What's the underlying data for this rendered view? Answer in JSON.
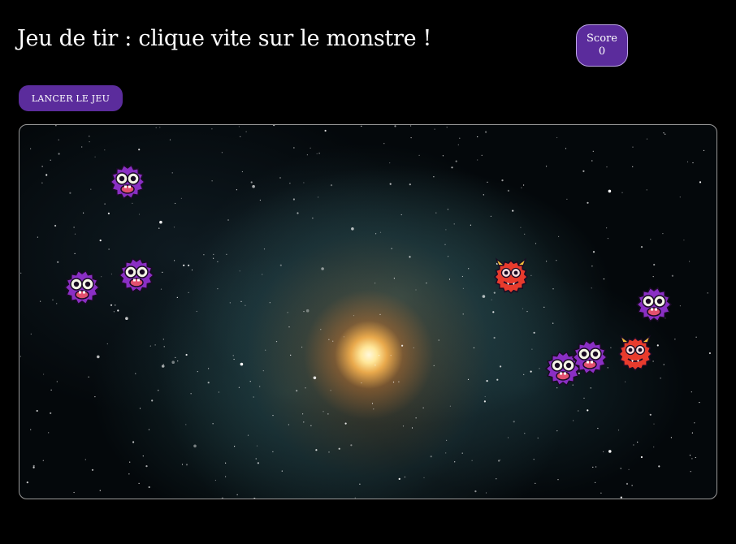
{
  "header": {
    "title": "Jeu de tir : clique vite sur le monstre !"
  },
  "score": {
    "label": "Score",
    "value": "0"
  },
  "controls": {
    "start_label": "LANCER LE JEU"
  },
  "colors": {
    "accent": "#5b2c9c",
    "background": "#000000",
    "monster_purple": "#8a2fc4",
    "monster_red": "#e83b2d"
  },
  "monsters": [
    {
      "kind": "purple",
      "icon": "purple-monster-icon"
    },
    {
      "kind": "purple",
      "icon": "purple-monster-icon"
    },
    {
      "kind": "purple",
      "icon": "purple-monster-icon"
    },
    {
      "kind": "red",
      "icon": "red-horned-monster-icon"
    },
    {
      "kind": "purple",
      "icon": "purple-monster-icon"
    },
    {
      "kind": "purple",
      "icon": "purple-monster-icon"
    },
    {
      "kind": "purple",
      "icon": "purple-monster-icon"
    },
    {
      "kind": "red",
      "icon": "red-horned-monster-icon"
    }
  ]
}
